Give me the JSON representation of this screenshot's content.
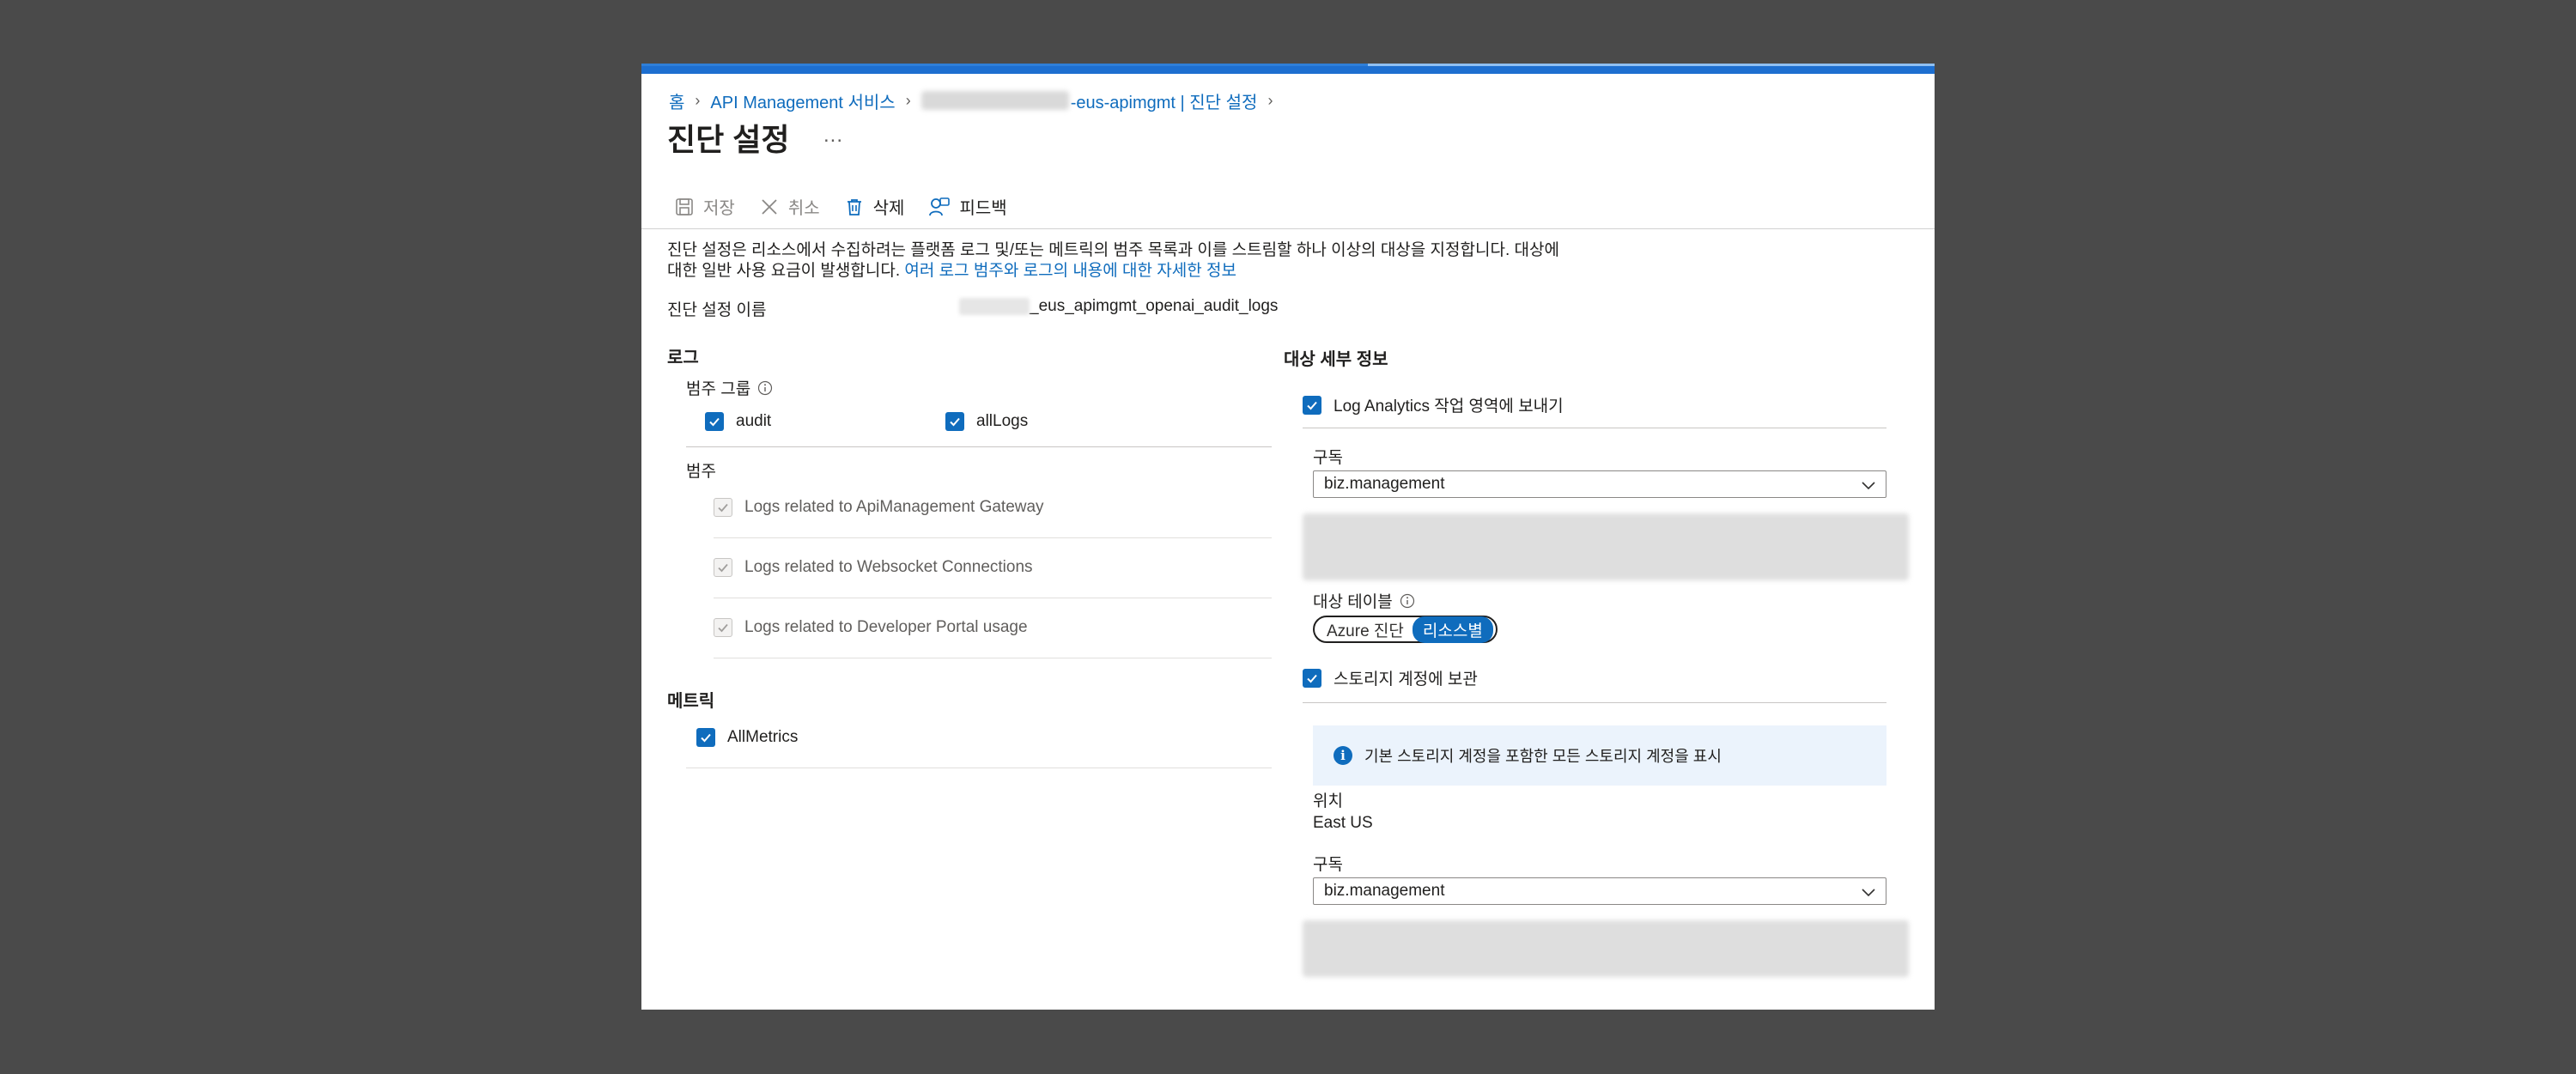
{
  "breadcrumb": {
    "home": "홈",
    "service": "API Management 서비스",
    "resource_suffix": "-eus-apimgmt | 진단 설정"
  },
  "page": {
    "title": "진단 설정",
    "more": "..."
  },
  "toolbar": {
    "save": "저장",
    "cancel": "취소",
    "delete": "삭제",
    "feedback": "피드백"
  },
  "description": {
    "text": "진단 설정은 리소스에서 수집하려는 플랫폼 로그 및/또는 메트릭의 범주 목록과 이를 스트림할 하나 이상의 대상을 지정합니다. 대상에 대한 일반 사용 요금이 발생합니다.",
    "link": "여러 로그 범주와 로그의 내용에 대한 자세한 정보"
  },
  "setting_name": {
    "label": "진단 설정 이름",
    "value_suffix": "_eus_apimgmt_openai_audit_logs"
  },
  "logs": {
    "title": "로그",
    "category_groups_label": "범주 그룹",
    "groups": [
      {
        "label": "audit",
        "checked": true
      },
      {
        "label": "allLogs",
        "checked": true
      }
    ],
    "categories_label": "범주",
    "categories": [
      {
        "label": "Logs related to ApiManagement Gateway",
        "checked": true,
        "disabled": true
      },
      {
        "label": "Logs related to Websocket Connections",
        "checked": true,
        "disabled": true
      },
      {
        "label": "Logs related to Developer Portal usage",
        "checked": true,
        "disabled": true
      }
    ]
  },
  "metrics": {
    "title": "메트릭",
    "items": [
      {
        "label": "AllMetrics",
        "checked": true
      }
    ]
  },
  "destination": {
    "title": "대상 세부 정보",
    "log_analytics": {
      "label": "Log Analytics 작업 영역에 보내기",
      "checked": true
    },
    "subscription_label": "구독",
    "subscription_value": "biz.management",
    "target_table_label": "대상 테이블",
    "target_table_options": [
      "Azure 진단",
      "리소스별"
    ],
    "target_table_selected": "리소스별",
    "storage": {
      "label": "스토리지 계정에 보관",
      "checked": true
    },
    "storage_info": "기본 스토리지 계정을 포함한 모든 스토리지 계정을 표시",
    "location_label": "위치",
    "location_value": "East US",
    "storage_subscription_label": "구독",
    "storage_subscription_value": "biz.management"
  },
  "colors": {
    "accent": "#0f6cbd",
    "background": "#4a4a4a",
    "panel": "#ffffff",
    "info_bg": "#ebf3fc"
  }
}
